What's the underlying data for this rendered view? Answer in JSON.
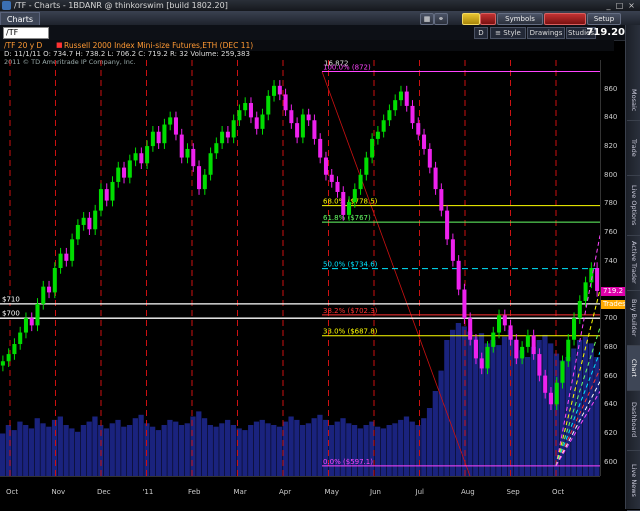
{
  "window": {
    "title": "/TF - Charts - 1BDANR @ thinkorswim [build 1802.20]",
    "min": "_",
    "max": "□",
    "close": "×"
  },
  "toolbar": {
    "tab": "Charts",
    "symbols": "Symbols",
    "setup": "Setup",
    "flag_colors": [
      "#ffcc00",
      "#c23232"
    ]
  },
  "symbol_row": {
    "symbol": "/TF",
    "timeframe": "D",
    "style": "Style",
    "drawings": "Drawings",
    "studies": "Studies",
    "last_price": "719.20"
  },
  "info": {
    "symbol_label": "/TF 20 y D",
    "description": "Russell 2000 Index Mini-size Futures,ETH (DEC 11)",
    "quote": "D: 11/1/11  O: 734.7  H: 738.2  L: 706.2  C: 719.2  R: 32  Volume: 259,383",
    "copyright": "2011 © TD Ameritrade IP Company, Inc."
  },
  "sidebar": {
    "tabs": [
      "Live News",
      "Dashboard",
      "Chart",
      "Buy Builder",
      "Active Trader",
      "Live Options",
      "Trade",
      "Mosaic"
    ]
  },
  "chart_data": {
    "type": "candlestick",
    "y_range": [
      590,
      880
    ],
    "y_ticks": [
      600,
      620,
      640,
      660,
      680,
      700,
      720,
      740,
      760,
      780,
      800,
      820,
      840,
      860
    ],
    "x_labels": [
      "Oct",
      "Nov",
      "Dec",
      "'11",
      "Feb",
      "Mar",
      "Apr",
      "May",
      "Jun",
      "Jul",
      "Aug",
      "Sep",
      "Oct"
    ],
    "candle_colors": {
      "up": "#00dd00",
      "down": "#ee22ee"
    },
    "volume_color": "#1a237e",
    "fibonacci": [
      {
        "label": "100.0%",
        "value": "872",
        "price": 872.0,
        "color": "#ff44ff"
      },
      {
        "label": "68.0%",
        "value": "$778.5",
        "price": 778.5,
        "color": "#ffff00"
      },
      {
        "label": "61.8%",
        "value": "$767",
        "price": 767.0,
        "color": "#66ff66"
      },
      {
        "label": "50.0%",
        "value": "$734.6",
        "price": 734.6,
        "color": "#00e5ff"
      },
      {
        "label": "38.2%",
        "value": "$702.3",
        "price": 702.3,
        "color": "#ff3333"
      },
      {
        "label": "33.0%",
        "value": "$687.8",
        "price": 687.8,
        "color": "#ffff00"
      },
      {
        "label": "0.0%",
        "value": "$597.1",
        "price": 597.1,
        "color": "#ff44ff"
      }
    ],
    "top_marker": "16.872",
    "price_lines": [
      {
        "label": "$710",
        "price": 710
      },
      {
        "label": "$700",
        "price": 700
      }
    ],
    "right_tags": [
      {
        "label": "719.2",
        "price": 719.2,
        "color": "#dd00aa"
      },
      {
        "label": "Tradestation",
        "price": 710,
        "color": "#ffaa00"
      }
    ],
    "closes": [
      670,
      675,
      682,
      690,
      700,
      695,
      710,
      722,
      718,
      735,
      745,
      740,
      755,
      765,
      770,
      762,
      775,
      790,
      782,
      795,
      805,
      798,
      810,
      815,
      808,
      820,
      830,
      822,
      835,
      840,
      828,
      812,
      818,
      806,
      790,
      800,
      815,
      822,
      830,
      826,
      838,
      845,
      850,
      840,
      832,
      842,
      855,
      862,
      856,
      845,
      836,
      826,
      842,
      838,
      825,
      812,
      800,
      795,
      788,
      772,
      781,
      790,
      800,
      812,
      825,
      830,
      838,
      845,
      852,
      858,
      848,
      836,
      828,
      818,
      805,
      790,
      775,
      755,
      740,
      720,
      700,
      685,
      672,
      665,
      680,
      690,
      702,
      695,
      685,
      672,
      680,
      688,
      675,
      660,
      648,
      640,
      655,
      670,
      685,
      700,
      712,
      725,
      735,
      719
    ],
    "volumes": [
      0.25,
      0.3,
      0.27,
      0.32,
      0.3,
      0.28,
      0.34,
      0.31,
      0.29,
      0.33,
      0.35,
      0.3,
      0.28,
      0.26,
      0.3,
      0.32,
      0.35,
      0.3,
      0.28,
      0.31,
      0.33,
      0.29,
      0.3,
      0.34,
      0.36,
      0.31,
      0.29,
      0.27,
      0.3,
      0.33,
      0.32,
      0.3,
      0.31,
      0.35,
      0.38,
      0.34,
      0.3,
      0.29,
      0.31,
      0.33,
      0.3,
      0.28,
      0.27,
      0.3,
      0.32,
      0.33,
      0.31,
      0.3,
      0.29,
      0.32,
      0.35,
      0.33,
      0.3,
      0.31,
      0.34,
      0.36,
      0.33,
      0.3,
      0.32,
      0.34,
      0.31,
      0.3,
      0.28,
      0.3,
      0.32,
      0.29,
      0.28,
      0.3,
      0.31,
      0.33,
      0.35,
      0.32,
      0.3,
      0.34,
      0.4,
      0.5,
      0.62,
      0.8,
      0.86,
      0.9,
      0.88,
      0.85,
      0.82,
      0.84,
      0.78,
      0.8,
      0.77,
      0.82,
      0.86,
      0.8,
      0.74,
      0.7,
      0.76,
      0.8,
      0.83,
      0.78,
      0.72,
      0.68,
      0.7,
      0.75,
      0.8,
      0.82,
      0.78,
      0.7
    ]
  }
}
